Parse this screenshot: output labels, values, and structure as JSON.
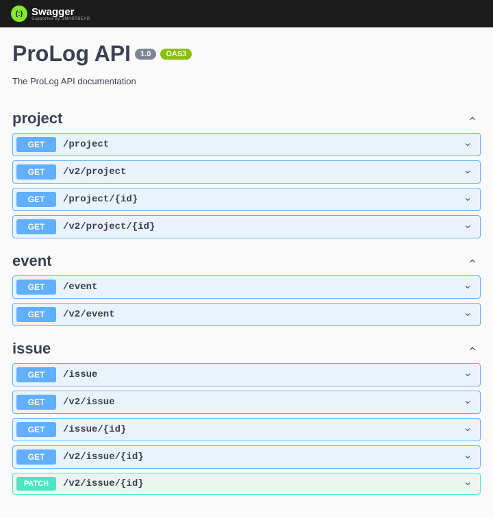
{
  "logo": {
    "brand": "Swagger",
    "supported": "Supported by SMARTBEAR",
    "glyph": "{:}"
  },
  "header": {
    "title": "ProLog API",
    "version": "1.0",
    "oas": "OAS3",
    "description": "The ProLog API documentation"
  },
  "tags": [
    {
      "name": "project",
      "ops": [
        {
          "method": "GET",
          "methodClass": "get",
          "path": "/project"
        },
        {
          "method": "GET",
          "methodClass": "get",
          "path": "/v2/project"
        },
        {
          "method": "GET",
          "methodClass": "get",
          "path": "/project/{id}"
        },
        {
          "method": "GET",
          "methodClass": "get",
          "path": "/v2/project/{id}"
        }
      ]
    },
    {
      "name": "event",
      "ops": [
        {
          "method": "GET",
          "methodClass": "get",
          "path": "/event"
        },
        {
          "method": "GET",
          "methodClass": "get",
          "path": "/v2/event"
        }
      ]
    },
    {
      "name": "issue",
      "ops": [
        {
          "method": "GET",
          "methodClass": "get",
          "path": "/issue"
        },
        {
          "method": "GET",
          "methodClass": "get",
          "path": "/v2/issue"
        },
        {
          "method": "GET",
          "methodClass": "get",
          "path": "/issue/{id}"
        },
        {
          "method": "GET",
          "methodClass": "get",
          "path": "/v2/issue/{id}"
        },
        {
          "method": "PATCH",
          "methodClass": "patch",
          "path": "/v2/issue/{id}"
        }
      ]
    }
  ]
}
